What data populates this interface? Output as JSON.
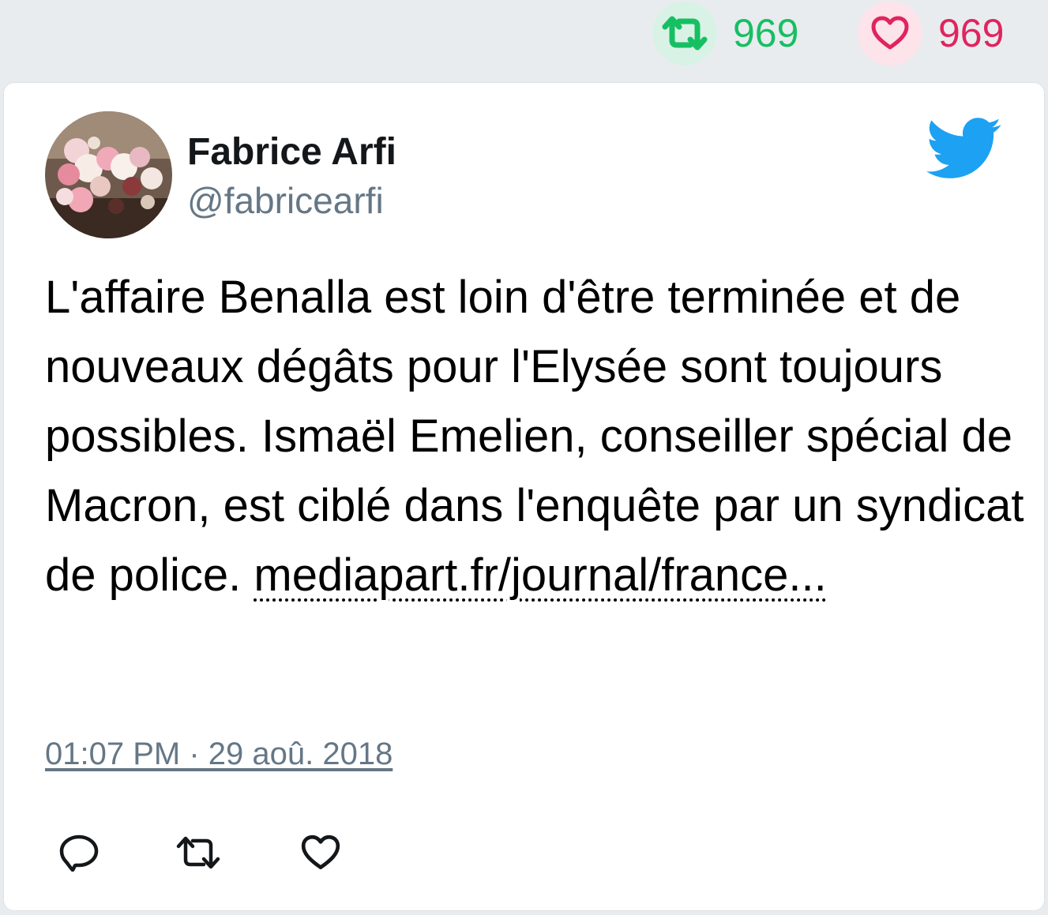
{
  "stats": {
    "retweet_count": "969",
    "like_count": "969",
    "retweet_color": "#17bf63",
    "like_color": "#e0245e"
  },
  "tweet": {
    "author": {
      "display_name": "Fabrice Arfi",
      "handle": "@fabricearfi",
      "avatar": "rose-painting-avatar"
    },
    "text": "L'affaire Benalla est loin d'être terminée et de nouveaux dégâts pour l'Elysée sont toujours possibles. Ismaël Emelien, conseiller spécial de Macron, est ciblé dans l'enquête par un syndicat de police.",
    "link_text": "mediapart.fr/journal/france...",
    "timestamp": "01:07 PM · 29 aoû. 2018"
  },
  "icons": {
    "brand": "twitter-bird-icon",
    "brand_color": "#1da1f2",
    "actions": [
      "reply-icon",
      "retweet-icon",
      "like-icon"
    ]
  }
}
